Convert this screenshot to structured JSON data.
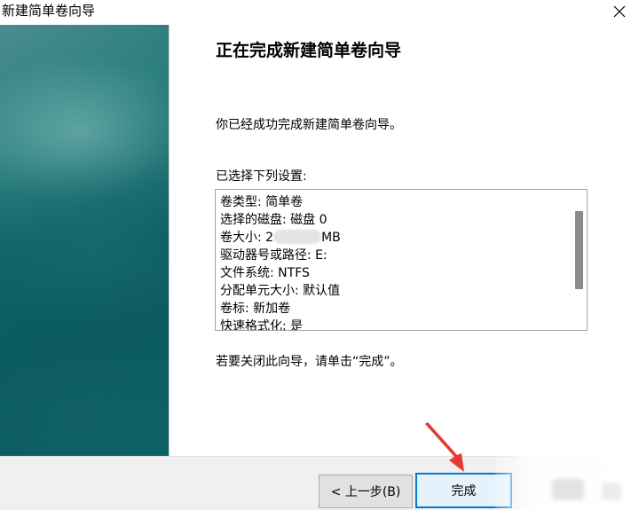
{
  "window": {
    "title": "新建简单卷向导",
    "close_label": "×"
  },
  "main": {
    "heading": "正在完成新建简单卷向导",
    "success_text": "你已经成功完成新建简单卷向导。",
    "settings_label": "已选择下列设置:",
    "settings": [
      {
        "text": "卷类型: 简单卷"
      },
      {
        "text": "选择的磁盘: 磁盘 0"
      },
      {
        "prefix": "卷大小: 2",
        "suffix": "MB"
      },
      {
        "text": "驱动器号或路径: E:"
      },
      {
        "text": "文件系统: NTFS"
      },
      {
        "text": "分配单元大小: 默认值"
      },
      {
        "text": "卷标: 新加卷"
      },
      {
        "text": "快速格式化: 是"
      }
    ],
    "close_hint": "若要关闭此向导，请单击“完成”。"
  },
  "footer": {
    "back_label": "< 上一步(B)",
    "finish_label": "完成"
  },
  "colors": {
    "side_panel": "#0d6166",
    "accent": "#0078d7",
    "annotation_arrow": "#e53935"
  }
}
